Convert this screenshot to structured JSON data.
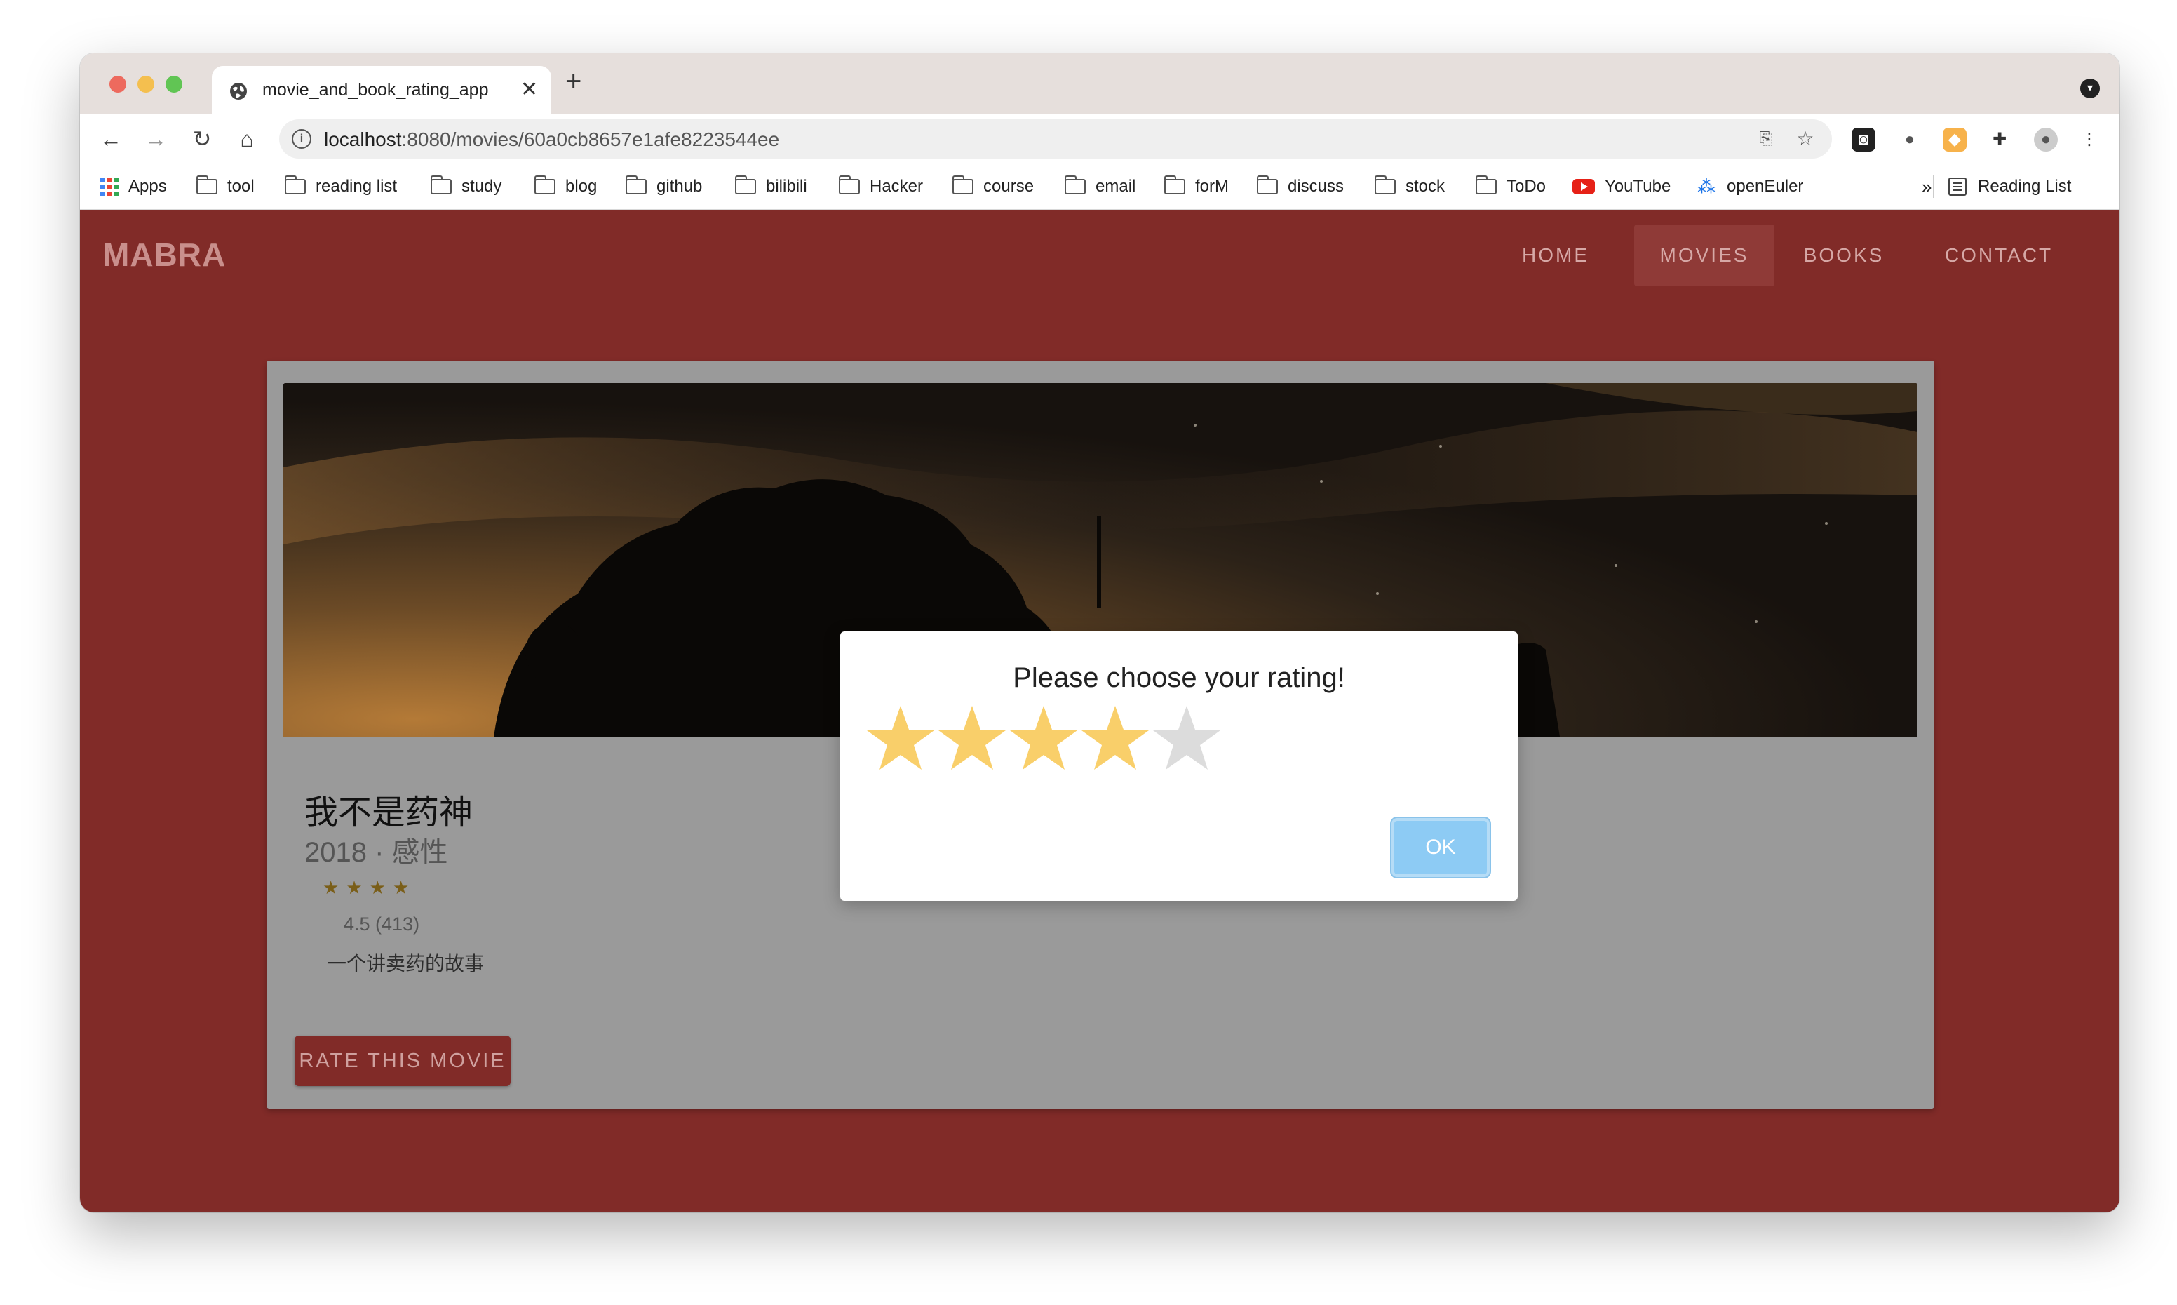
{
  "browser": {
    "tab_title": "movie_and_book_rating_app",
    "new_tab_symbol": "+",
    "url_host": "localhost",
    "url_path": ":8080/movies/60a0cb8657e1afe8223544ee"
  },
  "bookmarks": {
    "items": [
      "Apps",
      "tool",
      "reading list",
      "study",
      "blog",
      "github",
      "bilibili",
      "Hacker",
      "course",
      "email",
      "forM",
      "discuss",
      "stock",
      "ToDo",
      "YouTube",
      "openEuler"
    ],
    "overflow": "»",
    "reading_list": "Reading List"
  },
  "site": {
    "brand": "MABRA",
    "nav": [
      "HOME",
      "MOVIES",
      "BOOKS",
      "CONTACT"
    ],
    "active_nav": "MOVIES"
  },
  "movie": {
    "title": "我不是药神",
    "subtitle": "2018 · 感性",
    "rating_text": "4.5 (413)",
    "stars_shown": 4,
    "description": "一个讲卖药的故事",
    "rate_button": "RATE THIS MOVIE"
  },
  "modal": {
    "title": "Please choose your rating!",
    "rating_selected": 4,
    "rating_max": 5,
    "ok_label": "OK"
  },
  "colors": {
    "page_bg": "#812b28",
    "card_bg": "#9a9a9a",
    "star_filled": "#f9cf6a",
    "star_empty": "#dcdcdc",
    "ok_button": "#8dcbf4"
  }
}
